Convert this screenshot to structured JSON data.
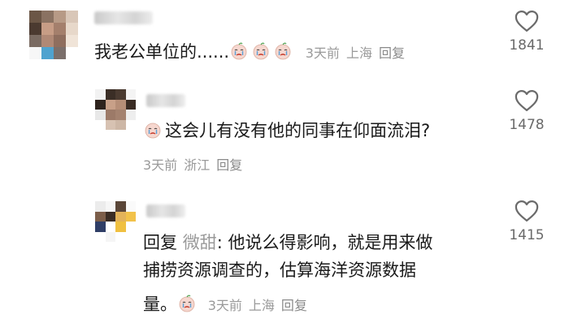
{
  "comments": [
    {
      "text": "我老公单位的......",
      "emoji_count": 3,
      "time": "3天前",
      "location": "上海",
      "reply_label": "回复",
      "likes": "1841"
    },
    {
      "text": "这会儿有没有他的同事在仰面流泪?",
      "time": "3天前",
      "location": "浙江",
      "reply_label": "回复",
      "likes": "1478"
    },
    {
      "reply_prefix": "回复",
      "mention": "微甜",
      "line1": ": 他说么得影响，就是用来做",
      "line2": "捕捞资源调查的，估算海洋资源数据",
      "line3": "量。",
      "time": "3天前",
      "location": "上海",
      "reply_label": "回复",
      "likes": "1415"
    }
  ],
  "colors": {
    "text": "#1a1a1a",
    "meta": "#9a9a9a",
    "heart": "#6b6b6b"
  },
  "icons": [
    "heart-outline-icon",
    "crying-emoji-icon"
  ]
}
